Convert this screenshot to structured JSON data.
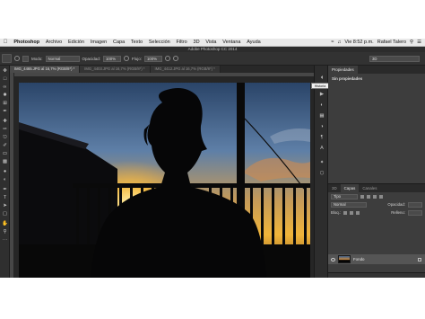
{
  "menubar": {
    "app_name": "Photoshop",
    "items": [
      "Archivo",
      "Edición",
      "Imagen",
      "Capa",
      "Texto",
      "Selección",
      "Filtro",
      "3D",
      "Vista",
      "Ventana",
      "Ayuda"
    ],
    "clock": "Vie 8:52 p.m.",
    "user": "Rafael Talero"
  },
  "window": {
    "title": "Adobe Photoshop CC 2014"
  },
  "options": {
    "mode_label": "Modo:",
    "mode_value": "Normal",
    "opacity_label": "Opacidad:",
    "opacity_value": "100%",
    "flow_label": "Flujo:",
    "flow_value": "100%",
    "workspace": "3D"
  },
  "documents": {
    "tabs": [
      "IMG_4465.JPG al 16,7% (RGB/8*) *",
      "IMG_4403.JPG al 16,7% (RGB/8*) *",
      "IMG_4412.JPG al 16,7% (RGB/8*) *"
    ]
  },
  "icon_strip": {
    "tooltip": "Historia"
  },
  "properties": {
    "tab_label": "Propiedades",
    "message": "Sin propiedades"
  },
  "layers": {
    "tabs": [
      "3D",
      "Capas",
      "Canales"
    ],
    "kind_value": "Tipo",
    "blend_value": "Normal",
    "opacity_label": "Opacidad:",
    "lock_label": "Bloq.:",
    "fill_label": "Relleno:",
    "layer_name": "Fondo"
  },
  "colors": {
    "foreground": "#23c9a9",
    "background": "#0e0e0e",
    "panel_bg": "#3d3d3d",
    "ui_dark": "#2d2d2d"
  }
}
